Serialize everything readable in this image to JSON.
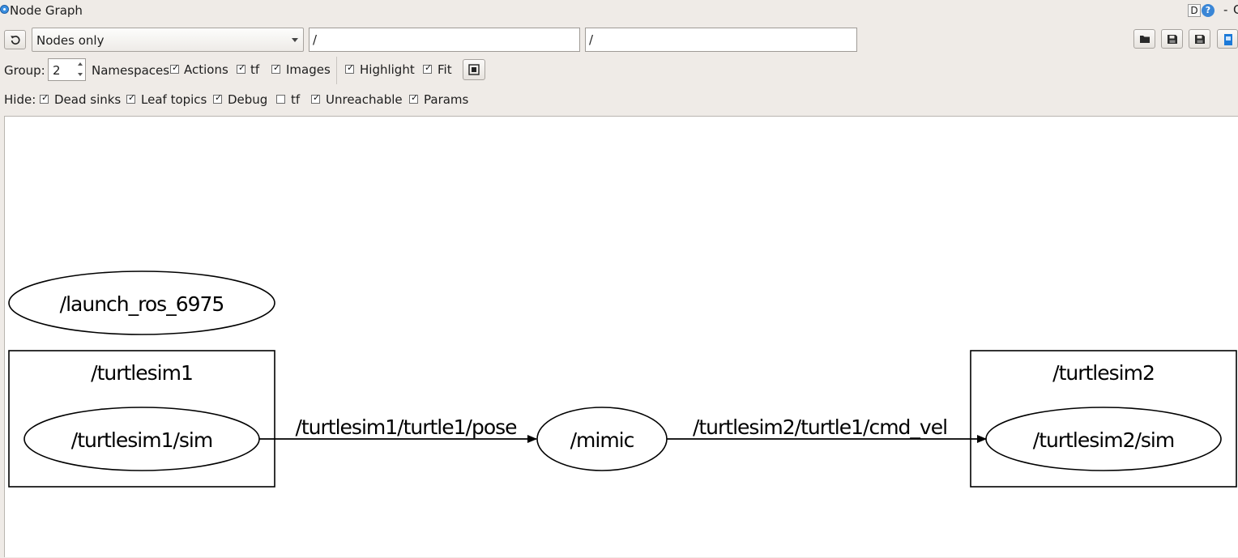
{
  "window": {
    "title": "Node Graph",
    "d_button_label": "D",
    "help_icon_label": "?",
    "dash": "-",
    "tail": "C"
  },
  "toolbar": {
    "graph_mode": "Nodes only",
    "node_filter": "/",
    "topic_filter": "/"
  },
  "options": {
    "group_label": "Group:",
    "group_value": "2",
    "namespaces_label": "Namespaces",
    "actions": {
      "label": "Actions",
      "checked": true
    },
    "tf": {
      "label": "tf",
      "checked": true
    },
    "images": {
      "label": "Images",
      "checked": true
    },
    "highlight": {
      "label": "Highlight",
      "checked": true
    },
    "fit": {
      "label": "Fit",
      "checked": true
    }
  },
  "hide": {
    "label": "Hide:",
    "dead_sinks": {
      "label": "Dead sinks",
      "checked": true
    },
    "leaf_topics": {
      "label": "Leaf topics",
      "checked": true
    },
    "debug": {
      "label": "Debug",
      "checked": true
    },
    "tf": {
      "label": "tf",
      "checked": false
    },
    "unreachable": {
      "label": "Unreachable",
      "checked": true
    },
    "params": {
      "label": "Params",
      "checked": true
    }
  },
  "graph": {
    "launch_node": "/launch_ros_6975",
    "group1_label": "/turtlesim1",
    "node_sim1": "/turtlesim1/sim",
    "edge1_label": "/turtlesim1/turtle1/pose",
    "node_mimic": "/mimic",
    "edge2_label": "/turtlesim2/turtle1/cmd_vel",
    "group2_label": "/turtlesim2",
    "node_sim2": "/turtlesim2/sim"
  }
}
